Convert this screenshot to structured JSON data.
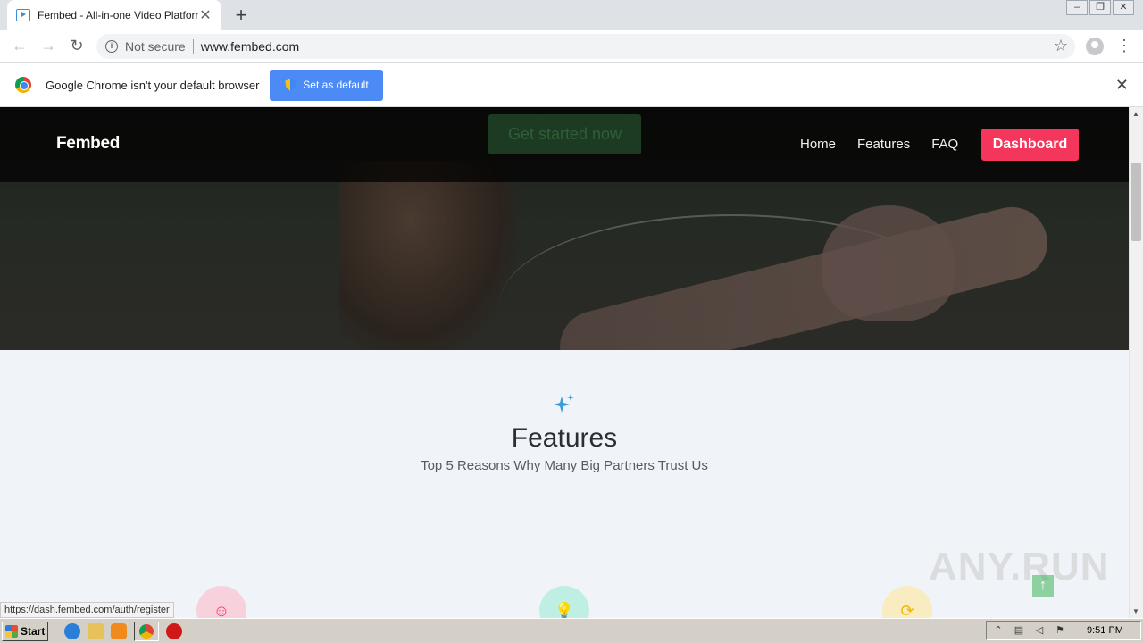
{
  "browser": {
    "tab_title": "Fembed - All-in-one Video Platform",
    "tab_close": "✕",
    "new_tab": "+",
    "security_label": "Not secure",
    "url": "www.fembed.com"
  },
  "infobar": {
    "message": "Google Chrome isn't your default browser",
    "button_label": "Set as default",
    "close": "✕"
  },
  "page": {
    "brand": "Fembed",
    "cta_label": "Get started now",
    "nav": [
      "Home",
      "Features",
      "FAQ"
    ],
    "dashboard_label": "Dashboard",
    "features_title": "Features",
    "features_subtitle": "Top 5 Reasons Why Many Big Partners Trust Us",
    "colors": {
      "accent": "#f5365c",
      "pink": "#f5365c",
      "teal": "#2dce89",
      "yellow": "#f0b800"
    }
  },
  "status_url": "https://dash.fembed.com/auth/register",
  "watermark": "ANY.RUN",
  "taskbar": {
    "start_label": "Start",
    "clock": "9:51 PM"
  }
}
